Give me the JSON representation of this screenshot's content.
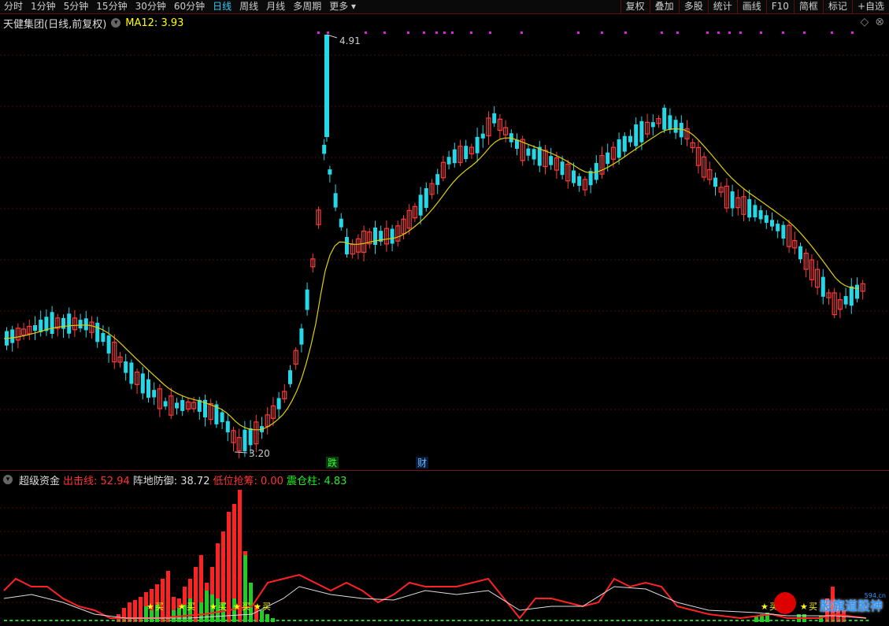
{
  "toolbar": {
    "periods": [
      "分时",
      "1分钟",
      "5分钟",
      "15分钟",
      "30分钟",
      "60分钟",
      "日线",
      "周线",
      "月线",
      "多周期",
      "更多"
    ],
    "active_period": "日线",
    "more_arrow": "▾",
    "right_items": [
      "复权",
      "叠加",
      "多股",
      "统计",
      "画线",
      "F10",
      "简框",
      "标记",
      "+自选"
    ]
  },
  "chart": {
    "stock_title": "天健集团(日线,前复权)",
    "ma_label": "MA12: 3.93",
    "high_label": "4.91",
    "low_label": "3.20",
    "event_die": "跌",
    "event_cai": "财",
    "colors": {
      "up": "#ff3b3b",
      "down": "#25d8e8",
      "ma": "#e0d000",
      "marker": "#e020e0"
    }
  },
  "indicator": {
    "name": "超级资金",
    "chuji": "出击线: 52.94",
    "zhendi": "阵地防御: 38.72",
    "diwei": "低位抢筹: 0.00",
    "zhencang": "震仓柱: 4.83",
    "buy_label": "买"
  },
  "watermark": {
    "text": "股旗道股神",
    "url": "594.cn"
  }
}
